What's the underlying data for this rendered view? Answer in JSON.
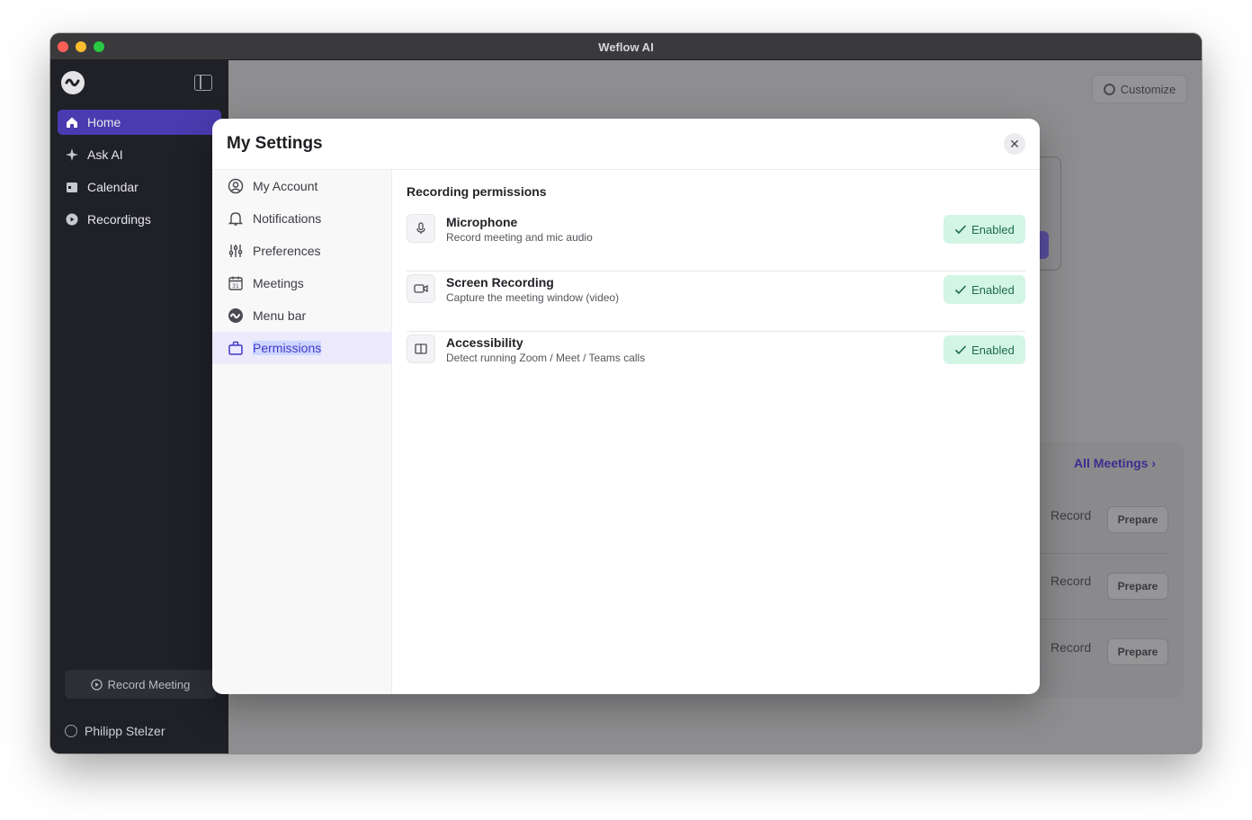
{
  "window": {
    "title": "Weflow AI"
  },
  "sidebar": {
    "items": [
      {
        "label": "Home",
        "icon": "home-icon",
        "active": true
      },
      {
        "label": "Ask AI",
        "icon": "sparkle-icon",
        "active": false
      },
      {
        "label": "Calendar",
        "icon": "calendar-icon",
        "active": false
      },
      {
        "label": "Recordings",
        "icon": "play-circle-icon",
        "active": false
      }
    ],
    "record_button": "Record Meeting",
    "user_name": "Philipp Stelzer"
  },
  "main": {
    "customize_label": "Customize",
    "all_meetings_label": "All Meetings",
    "meeting_rows": [
      {
        "record": "Record",
        "prepare": "Prepare"
      },
      {
        "record": "Record",
        "prepare": "Prepare"
      },
      {
        "record": "Record",
        "prepare": "Prepare"
      }
    ]
  },
  "modal": {
    "title": "My Settings",
    "nav": [
      {
        "label": "My Account",
        "icon": "user-circle-icon"
      },
      {
        "label": "Notifications",
        "icon": "bell-icon"
      },
      {
        "label": "Preferences",
        "icon": "sliders-icon"
      },
      {
        "label": "Meetings",
        "icon": "calendar-31-icon"
      },
      {
        "label": "Menu bar",
        "icon": "weflow-logo-icon"
      },
      {
        "label": "Permissions",
        "icon": "briefcase-icon",
        "active": true
      }
    ],
    "section_title": "Recording permissions",
    "permissions": [
      {
        "name": "Microphone",
        "description": "Record meeting and mic audio",
        "status": "Enabled",
        "icon": "microphone-icon"
      },
      {
        "name": "Screen Recording",
        "description": "Capture the meeting window (video)",
        "status": "Enabled",
        "icon": "video-camera-icon"
      },
      {
        "name": "Accessibility",
        "description": "Detect running Zoom / Meet / Teams calls",
        "status": "Enabled",
        "icon": "columns-icon"
      }
    ]
  },
  "colors": {
    "accent": "#4b3bb0",
    "enabled_bg": "#d3f5e6",
    "enabled_text": "#1f6b4b",
    "sidebar_bg": "#1f2127"
  }
}
